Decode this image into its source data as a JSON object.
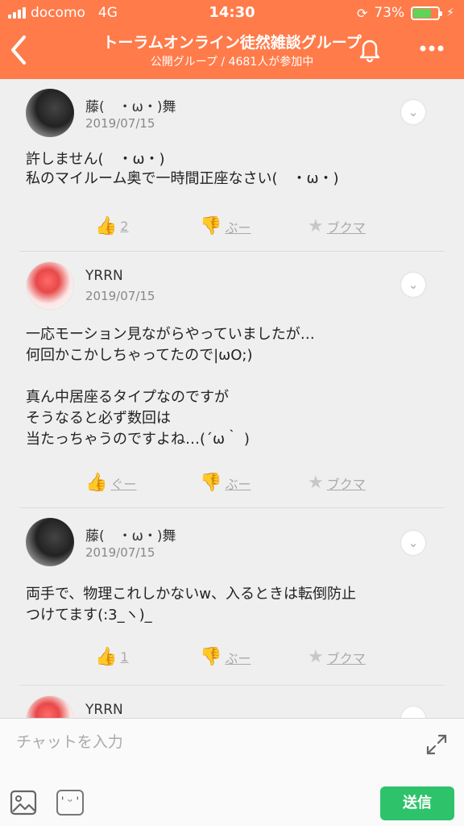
{
  "status_bar": {
    "carrier": "docomo",
    "network": "4G",
    "time": "14:30",
    "battery": "73%",
    "battery_level": 0.73
  },
  "header": {
    "back_icon": "chevron-left-icon",
    "title": "トーラムオンライン徒然雑談グループ",
    "subtitle": "公開グループ / 4681人が参加中",
    "bell_icon": "bell-icon",
    "more_icon": "more-icon"
  },
  "posts": [
    {
      "author": "藤(　・ω・)舞",
      "date": "2019/07/15",
      "body": "許しません(　・ω・)\n私のマイルーム奥で一時間正座なさい(　・ω・)",
      "like_label": "2",
      "dislike_label": "ぶー",
      "bookmark_label": "ブクマ"
    },
    {
      "author": "YRRN",
      "date": "2019/07/15",
      "body": "一応モーション見ながらやっていましたが…\n何回かこかしちゃってたので|ωO;)\n\n真ん中居座るタイプなのですが\nそうなると必ず数回は\n当たっちゃうのですよね…(´ω｀ )",
      "like_label": "ぐー",
      "dislike_label": "ぶー",
      "bookmark_label": "ブクマ"
    },
    {
      "author": "藤(　・ω・)舞",
      "date": "2019/07/15",
      "body": "両手で、物理これしかないw、入るときは転倒防止\nつけてます(:3_ヽ)_",
      "like_label": "1",
      "dislike_label": "ぶー",
      "bookmark_label": "ブクマ"
    },
    {
      "author": "YRRN"
    }
  ],
  "composer": {
    "placeholder": "チャットを入力",
    "emoji_label": "' ᵕ '",
    "send_label": "送信"
  }
}
